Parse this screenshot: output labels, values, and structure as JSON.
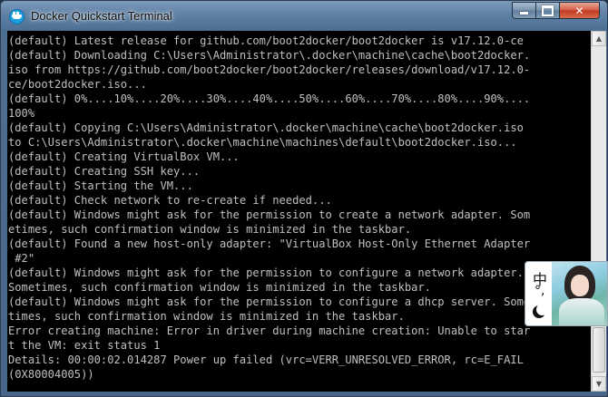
{
  "window": {
    "title": "Docker Quickstart Terminal",
    "accent_color": "#5f81a5",
    "icons": {
      "app": "docker-whale-icon",
      "minimize": "minimize-icon",
      "maximize": "maximize-icon",
      "close": "close-icon"
    },
    "close_glyph": "✕"
  },
  "terminal": {
    "background": "#000000",
    "foreground": "#c0c0c0",
    "lines": [
      "(default) Latest release for github.com/boot2docker/boot2docker is v17.12.0-ce",
      "(default) Downloading C:\\Users\\Administrator\\.docker\\machine\\cache\\boot2docker.iso from https://github.com/boot2docker/boot2docker/releases/download/v17.12.0-ce/boot2docker.iso...",
      "(default) 0%....10%....20%....30%....40%....50%....60%....70%....80%....90%....100%",
      "(default) Copying C:\\Users\\Administrator\\.docker\\machine\\cache\\boot2docker.iso to C:\\Users\\Administrator\\.docker\\machine\\machines\\default\\boot2docker.iso...",
      "(default) Creating VirtualBox VM...",
      "(default) Creating SSH key...",
      "(default) Starting the VM...",
      "(default) Check network to re-create if needed...",
      "(default) Windows might ask for the permission to create a network adapter. Sometimes, such confirmation window is minimized in the taskbar.",
      "(default) Found a new host-only adapter: \"VirtualBox Host-Only Ethernet Adapter #2\"",
      "(default) Windows might ask for the permission to configure a network adapter. Sometimes, such confirmation window is minimized in the taskbar.",
      "(default) Windows might ask for the permission to configure a dhcp server. Sometimes, such confirmation window is minimized in the taskbar.",
      "Error creating machine: Error in driver during machine creation: Unable to start the VM: exit status 1",
      "Details: 00:00:02.014287 Power up failed (vrc=VERR_UNRESOLVED_ERROR, rc=E_FAIL (0X80004005))"
    ],
    "wrap_columns": 79
  },
  "scrollbar": {
    "up_glyph": "▲",
    "down_glyph": "▼",
    "position_fraction": 1.0
  },
  "ime": {
    "mode_char": "中",
    "punct_char": "°,",
    "icons": {
      "mode": "chinese-mode-icon",
      "punctuation": "punctuation-icon",
      "half_width": "moon-icon",
      "skin": "ime-skin-image"
    }
  }
}
